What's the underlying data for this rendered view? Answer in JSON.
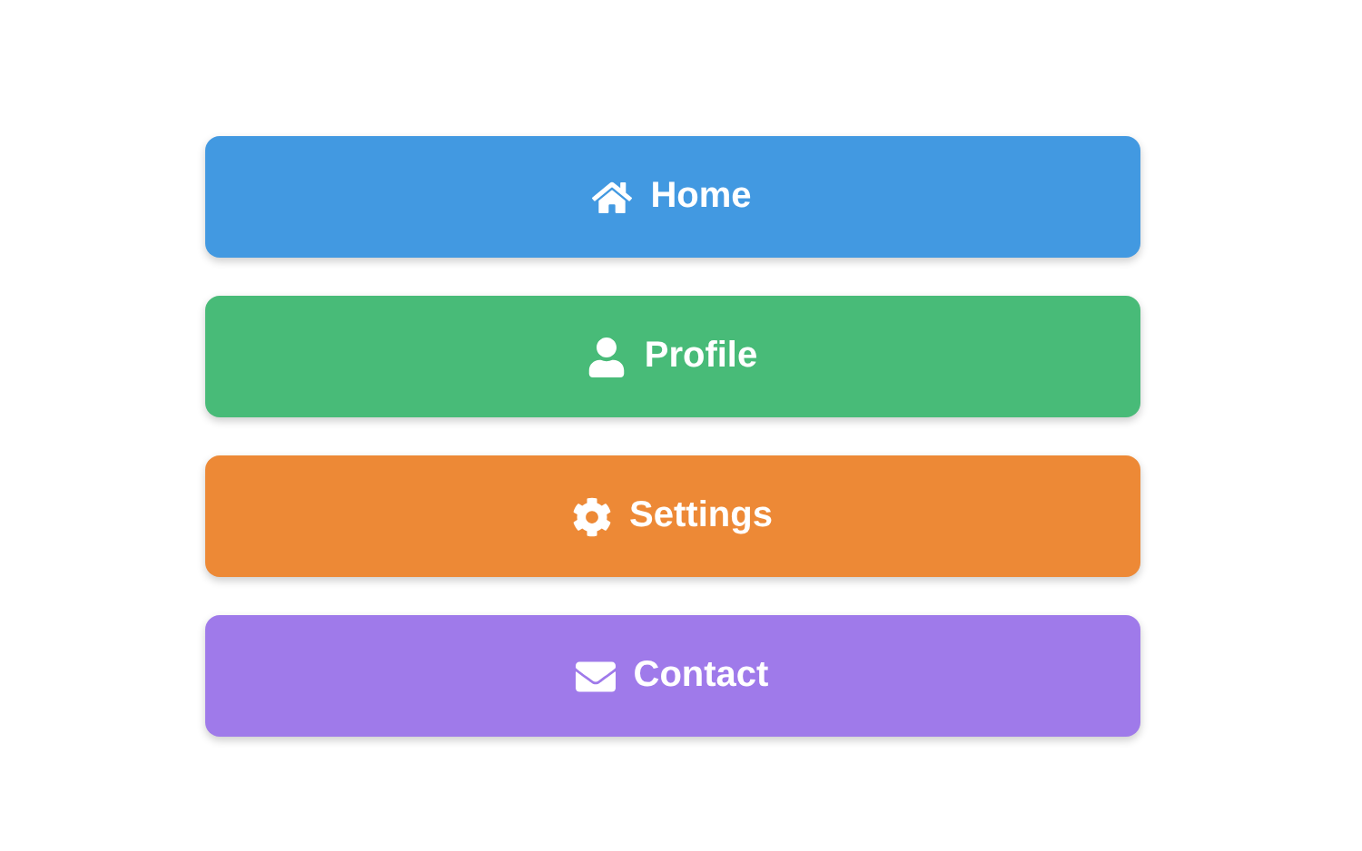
{
  "buttons": [
    {
      "label": "Home",
      "color": "#4299e1"
    },
    {
      "label": "Profile",
      "color": "#48bb78"
    },
    {
      "label": "Settings",
      "color": "#ed8936"
    },
    {
      "label": "Contact",
      "color": "#9f7aea"
    }
  ]
}
